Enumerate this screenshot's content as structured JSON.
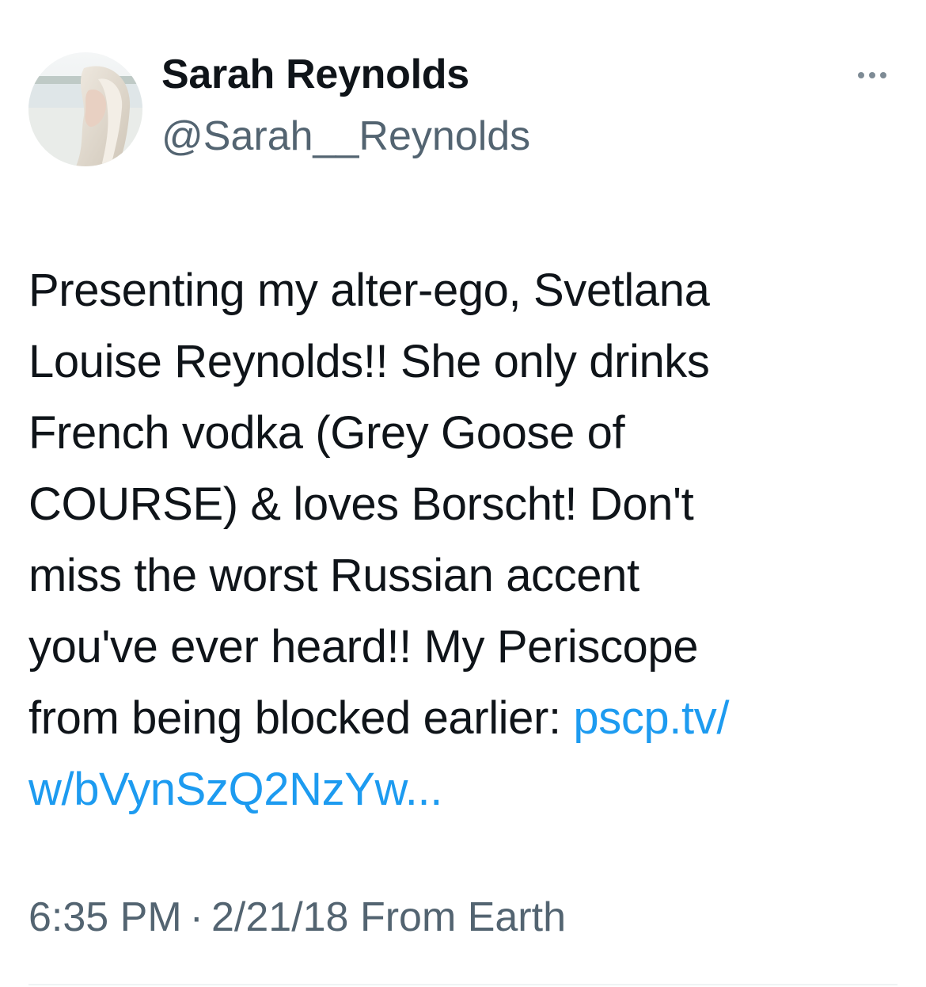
{
  "author": {
    "display_name": "Sarah Reynolds",
    "handle": "@Sarah__Reynolds",
    "avatar_icon": "profile-photo"
  },
  "tweet": {
    "lines": [
      "Presenting my alter-ego, Svetlana",
      "Louise Reynolds!! She only drinks",
      "French vodka (Grey Goose of",
      "COURSE) & loves Borscht! Don't",
      "miss the worst Russian accent",
      "you've ever heard!! My Periscope"
    ],
    "last_line_text": "from being blocked earlier: ",
    "link_part1": "pscp.tv/",
    "link_part2": "w/bVynSzQ2NzYw...",
    "link_color": "#1d9bf0"
  },
  "meta": {
    "time": "6:35 PM",
    "separator": "·",
    "date": "2/21/18",
    "source": "From Earth"
  },
  "menu": {
    "more_icon": "more-horizontal-icon"
  }
}
